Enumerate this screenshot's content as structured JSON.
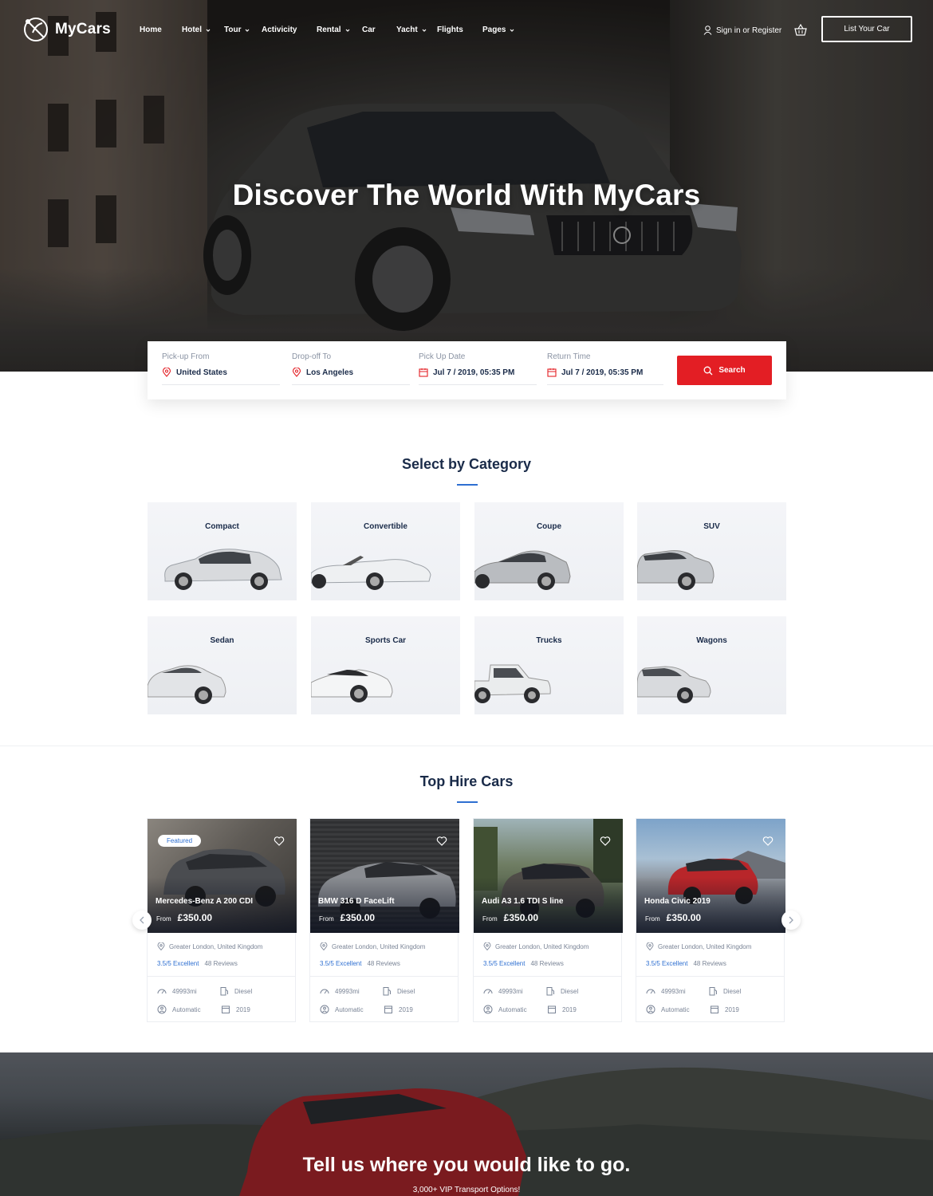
{
  "brand": {
    "name": "MyCars"
  },
  "nav": {
    "items": [
      {
        "label": "Home",
        "dropdown": false
      },
      {
        "label": "Hotel",
        "dropdown": true
      },
      {
        "label": "Tour",
        "dropdown": true
      },
      {
        "label": "Activicity",
        "dropdown": false
      },
      {
        "label": "Rental",
        "dropdown": true
      },
      {
        "label": "Car",
        "dropdown": false
      },
      {
        "label": "Yacht",
        "dropdown": true
      },
      {
        "label": "Flights",
        "dropdown": false
      },
      {
        "label": "Pages",
        "dropdown": true
      }
    ],
    "signin": "Sign in or Register",
    "list_car": "List Your Car"
  },
  "hero": {
    "title": "Discover The World With MyCars"
  },
  "search": {
    "pickup": {
      "label": "Pick-up From",
      "value": "United States",
      "icon": "map-pin-icon"
    },
    "dropoff": {
      "label": "Drop-off To",
      "value": "Los Angeles",
      "icon": "map-pin-icon"
    },
    "pickup_date": {
      "label": "Pick Up Date",
      "value": "Jul 7 / 2019, 05:35 PM",
      "icon": "calendar-icon"
    },
    "return_time": {
      "label": "Return Time",
      "value": "Jul 7 / 2019, 05:35 PM",
      "icon": "calendar-icon"
    },
    "button": "Search"
  },
  "categories": {
    "title": "Select by Category",
    "items": [
      "Compact",
      "Convertible",
      "Coupe",
      "SUV",
      "Sedan",
      "Sports Car",
      "Trucks",
      "Wagons"
    ]
  },
  "top_hire": {
    "title": "Top Hire Cars",
    "cars": [
      {
        "name": "Mercedes-Benz A 200 CDI",
        "from": "From",
        "price": "£350.00",
        "featured": "Featured",
        "location": "Greater London, United Kingdom",
        "score": "3.5/5 Excellent",
        "reviews": "48 Reviews",
        "mileage": "49993mi",
        "fuel": "Diesel",
        "transmission": "Automatic",
        "year": "2019"
      },
      {
        "name": "BMW 316 D FaceLift",
        "from": "From",
        "price": "£350.00",
        "featured": "",
        "location": "Greater London, United Kingdom",
        "score": "3.5/5 Excellent",
        "reviews": "48 Reviews",
        "mileage": "49993mi",
        "fuel": "Diesel",
        "transmission": "Automatic",
        "year": "2019"
      },
      {
        "name": "Audi A3 1.6 TDI S line",
        "from": "From",
        "price": "£350.00",
        "featured": "",
        "location": "Greater London, United Kingdom",
        "score": "3.5/5 Excellent",
        "reviews": "48 Reviews",
        "mileage": "49993mi",
        "fuel": "Diesel",
        "transmission": "Automatic",
        "year": "2019"
      },
      {
        "name": "Honda Civic 2019",
        "from": "From",
        "price": "£350.00",
        "featured": "",
        "location": "Greater London, United Kingdom",
        "score": "3.5/5 Excellent",
        "reviews": "48 Reviews",
        "mileage": "49993mi",
        "fuel": "Diesel",
        "transmission": "Automatic",
        "year": "2019"
      }
    ]
  },
  "banner": {
    "title": "Tell us where you would like to go.",
    "subtitle": "3,000+ VIP Transport Options!"
  },
  "colors": {
    "accent": "#e31e24",
    "link": "#2e6fd1",
    "heading": "#1a2b49"
  }
}
